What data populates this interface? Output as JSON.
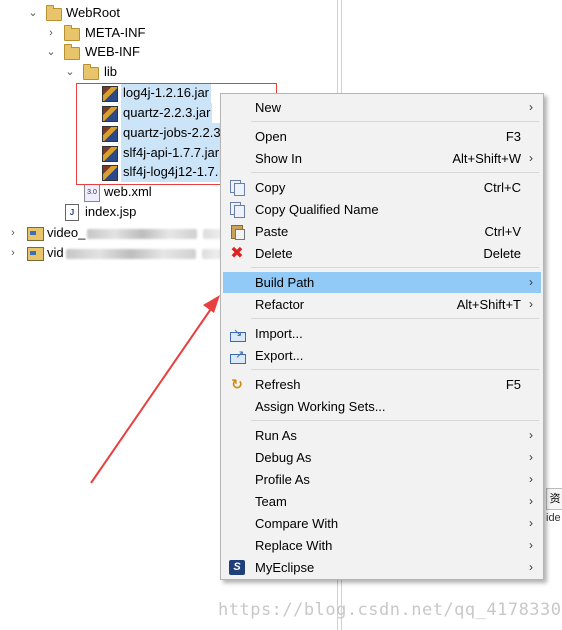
{
  "tree": {
    "items": [
      {
        "label": "WebRoot"
      },
      {
        "label": "META-INF"
      },
      {
        "label": "WEB-INF"
      },
      {
        "label": "lib"
      },
      {
        "label": "log4j-1.2.16.jar"
      },
      {
        "label": "quartz-2.2.3.jar"
      },
      {
        "label": "quartz-jobs-2.2.3"
      },
      {
        "label": "slf4j-api-1.7.7.jar"
      },
      {
        "label": "slf4j-log4j12-1.7."
      },
      {
        "label": "web.xml"
      },
      {
        "label": "index.jsp"
      },
      {
        "label": "video_"
      },
      {
        "label": "vid"
      }
    ]
  },
  "context_menu": {
    "items": [
      {
        "label": "New",
        "shortcut": ""
      },
      {
        "label": "Open",
        "shortcut": "F3"
      },
      {
        "label": "Show In",
        "shortcut": "Alt+Shift+W"
      },
      {
        "label": "Copy",
        "shortcut": "Ctrl+C"
      },
      {
        "label": "Copy Qualified Name",
        "shortcut": ""
      },
      {
        "label": "Paste",
        "shortcut": "Ctrl+V"
      },
      {
        "label": "Delete",
        "shortcut": "Delete"
      },
      {
        "label": "Build Path",
        "shortcut": ""
      },
      {
        "label": "Refactor",
        "shortcut": "Alt+Shift+T"
      },
      {
        "label": "Import...",
        "shortcut": ""
      },
      {
        "label": "Export...",
        "shortcut": ""
      },
      {
        "label": "Refresh",
        "shortcut": "F5"
      },
      {
        "label": "Assign Working Sets...",
        "shortcut": ""
      },
      {
        "label": "Run As",
        "shortcut": ""
      },
      {
        "label": "Debug As",
        "shortcut": ""
      },
      {
        "label": "Profile As",
        "shortcut": ""
      },
      {
        "label": "Team",
        "shortcut": ""
      },
      {
        "label": "Compare With",
        "shortcut": ""
      },
      {
        "label": "Replace With",
        "shortcut": ""
      },
      {
        "label": "MyEclipse",
        "shortcut": ""
      }
    ],
    "highlighted": "Build Path"
  },
  "right_pane": {
    "tab_text": "资",
    "text": "ide"
  },
  "watermark": "https://blog.csdn.net/qq_41783309",
  "colors": {
    "highlight": "#91c9f7",
    "selection": "#cce4f7",
    "annotation": "#e84040"
  }
}
